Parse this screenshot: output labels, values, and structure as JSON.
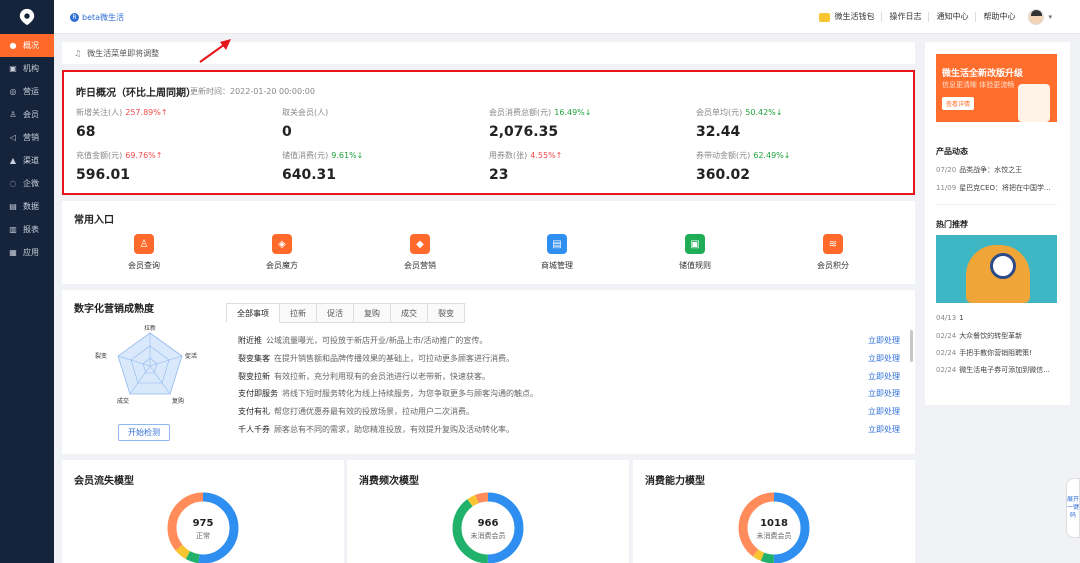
{
  "sidebar": {
    "items": [
      {
        "label": "概况",
        "icon": "dashboard-icon",
        "glyph": "●",
        "active": true
      },
      {
        "label": "机构",
        "icon": "building-icon",
        "glyph": "▣"
      },
      {
        "label": "营运",
        "icon": "operation-icon",
        "glyph": "◎"
      },
      {
        "label": "会员",
        "icon": "member-icon",
        "glyph": "♙"
      },
      {
        "label": "营销",
        "icon": "megaphone-icon",
        "glyph": "◁"
      },
      {
        "label": "渠道",
        "icon": "channel-icon",
        "glyph": "▲"
      },
      {
        "label": "企微",
        "icon": "wecom-icon",
        "glyph": "◌"
      },
      {
        "label": "数据",
        "icon": "data-icon",
        "glyph": "▤"
      },
      {
        "label": "报表",
        "icon": "report-icon",
        "glyph": "▥"
      },
      {
        "label": "应用",
        "icon": "apps-icon",
        "glyph": "▦"
      }
    ]
  },
  "header": {
    "brand": "beta微生活",
    "wallet": "微生活钱包",
    "log": "操作日志",
    "notify": "通知中心",
    "help": "帮助中心"
  },
  "notice": "微生活菜单即将调整",
  "overview": {
    "title": "昨日概况（环比上周同期）",
    "updated": "更新时间：2022-01-20 00:00:00",
    "stats": [
      {
        "label": "新增关注(人)",
        "pct": "257.89%↑",
        "dir": "up",
        "value": "68"
      },
      {
        "label": "取关会员(人)",
        "pct": "",
        "dir": "",
        "value": "0"
      },
      {
        "label": "会员消费总额(元)",
        "pct": "16.49%↓",
        "dir": "dn",
        "value": "2,076.35"
      },
      {
        "label": "会员单均(元)",
        "pct": "50.42%↓",
        "dir": "dn",
        "value": "32.44"
      },
      {
        "label": "充值金额(元)",
        "pct": "69.76%↑",
        "dir": "up",
        "value": "596.01"
      },
      {
        "label": "储值消费(元)",
        "pct": "9.61%↓",
        "dir": "dn",
        "value": "640.31"
      },
      {
        "label": "用券数(张)",
        "pct": "4.55%↑",
        "dir": "up",
        "value": "23"
      },
      {
        "label": "券带动金额(元)",
        "pct": "62.49%↓",
        "dir": "dn",
        "value": "360.02"
      }
    ]
  },
  "common": {
    "title": "常用入口",
    "entries": [
      {
        "label": "会员查询",
        "icon": "member-search-icon",
        "color": "#ff6a2b",
        "glyph": "♙"
      },
      {
        "label": "会员魔方",
        "icon": "member-cube-icon",
        "color": "#ff6a2b",
        "glyph": "◈"
      },
      {
        "label": "会员营销",
        "icon": "member-marketing-icon",
        "color": "#ff6a2b",
        "glyph": "◆"
      },
      {
        "label": "商城管理",
        "icon": "mall-icon",
        "color": "#2f8ff0",
        "glyph": "▤"
      },
      {
        "label": "储值规则",
        "icon": "stored-value-icon",
        "color": "#1fae57",
        "glyph": "▣"
      },
      {
        "label": "会员积分",
        "icon": "points-icon",
        "color": "#ff6a2b",
        "glyph": "≋"
      }
    ]
  },
  "digital": {
    "title": "数字化营销成熟度",
    "radar_labels": [
      "拉新",
      "促活",
      "复购",
      "成交",
      "裂变"
    ],
    "button": "开始检测",
    "tabs": [
      "全部事项",
      "拉新",
      "促活",
      "复购",
      "成交",
      "裂变"
    ],
    "tasks": [
      {
        "name": "附近推",
        "desc": "公域流量曝光，可投放于新店开业/新品上市/活动推广的宣传。",
        "action": "立即处理"
      },
      {
        "name": "裂变集客",
        "desc": "在提升销售额和品牌传播效果的基础上，可拉动更多顾客进行消费。",
        "action": "立即处理"
      },
      {
        "name": "裂变拉新",
        "desc": "有效拉新，充分利用现有的会员池进行以老带新，快速获客。",
        "action": "立即处理"
      },
      {
        "name": "支付即服务",
        "desc": "将线下短时服务转化为线上持续服务，为您争取更多与顾客沟通的触点。",
        "action": "立即处理"
      },
      {
        "name": "支付有礼",
        "desc": "帮您打通优惠券最有效的投放场景，拉动用户二次消费。",
        "action": "立即处理"
      },
      {
        "name": "千人千券",
        "desc": "顾客总有不同的需求，助您精准投放，有效提升复购及活动转化率。",
        "action": "立即处理"
      }
    ]
  },
  "models": [
    {
      "title": "会员流失模型",
      "number": "975",
      "sub": "正常"
    },
    {
      "title": "消费频次模型",
      "number": "966",
      "sub": "未消费会员"
    },
    {
      "title": "消费能力模型",
      "number": "1018",
      "sub": "未消费会员"
    }
  ],
  "right": {
    "banner_title": "微生活全新改版升级",
    "banner_sub": "信息更清晰 体验更流畅",
    "banner_btn": "查看详情",
    "news_title": "产品动态",
    "news": [
      {
        "date": "07/20",
        "text": "品类战争：水饺之王"
      },
      {
        "date": "11/09",
        "text": "星巴克CEO：将把在中国学..."
      }
    ],
    "hot_title": "热门推荐",
    "hot": [
      {
        "date": "04/13",
        "text": "1"
      },
      {
        "date": "02/24",
        "text": "大众餐饮的转型革新"
      },
      {
        "date": "02/24",
        "text": "手把手教你营销阻聘策!"
      },
      {
        "date": "02/24",
        "text": "微生活电子券可添加到微信..."
      }
    ]
  },
  "expand": "展开一键码"
}
